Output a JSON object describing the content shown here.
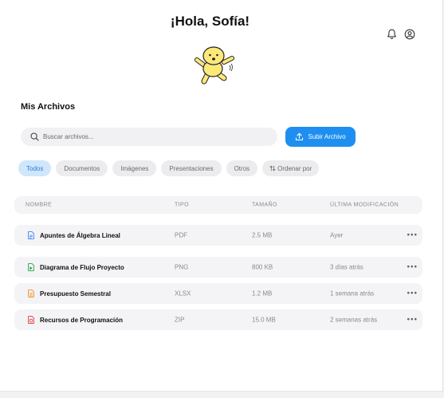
{
  "header": {
    "greeting": "¡Hola, Sofía!",
    "icons": [
      "bell-icon",
      "user-icon"
    ]
  },
  "section_title": "Mis Archivos",
  "search": {
    "placeholder": "Buscar archivos..."
  },
  "upload_button": {
    "label": "Subir Archivo",
    "icon": "upload-icon"
  },
  "filters": [
    {
      "label": "Todos",
      "active": true
    },
    {
      "label": "Documentos",
      "active": false
    },
    {
      "label": "Imágenes",
      "active": false
    },
    {
      "label": "Presentaciones",
      "active": false
    },
    {
      "label": "Otros",
      "active": false
    }
  ],
  "sort": {
    "label": "Ordenar por",
    "icon": "sort-icon"
  },
  "table": {
    "headers": {
      "name": "NOMBRE",
      "type": "TIPO",
      "size": "TAMAÑO",
      "modified": "ÚLTIMA MODIFICACIÓN"
    },
    "rows": [
      {
        "name": "Apuntes de Álgebra Lineal",
        "type": "PDF",
        "size": "2.5 MB",
        "modified": "Ayer",
        "icon_color": "#3b82f6",
        "icon": "document-icon"
      },
      {
        "name": "Diagrama de Flujo Proyecto",
        "type": "PNG",
        "size": "800 KB",
        "modified": "3 días atrás",
        "icon_color": "#22a447",
        "icon": "image-file-icon"
      },
      {
        "name": "Presupuesto Semestral",
        "type": "XLSX",
        "size": "1.2 MB",
        "modified": "1 semana atrás",
        "icon_color": "#f28a1c",
        "icon": "spreadsheet-icon"
      },
      {
        "name": "Recursos de Programación",
        "type": "ZIP",
        "size": "15.0 MB",
        "modified": "2 semanas atrás",
        "icon_color": "#e0383e",
        "icon": "archive-icon"
      }
    ],
    "more_label": "•••"
  },
  "colors": {
    "accent": "#1e8ff0",
    "active_chip_bg": "#cfe6fb",
    "mascot": "#fde87a"
  }
}
